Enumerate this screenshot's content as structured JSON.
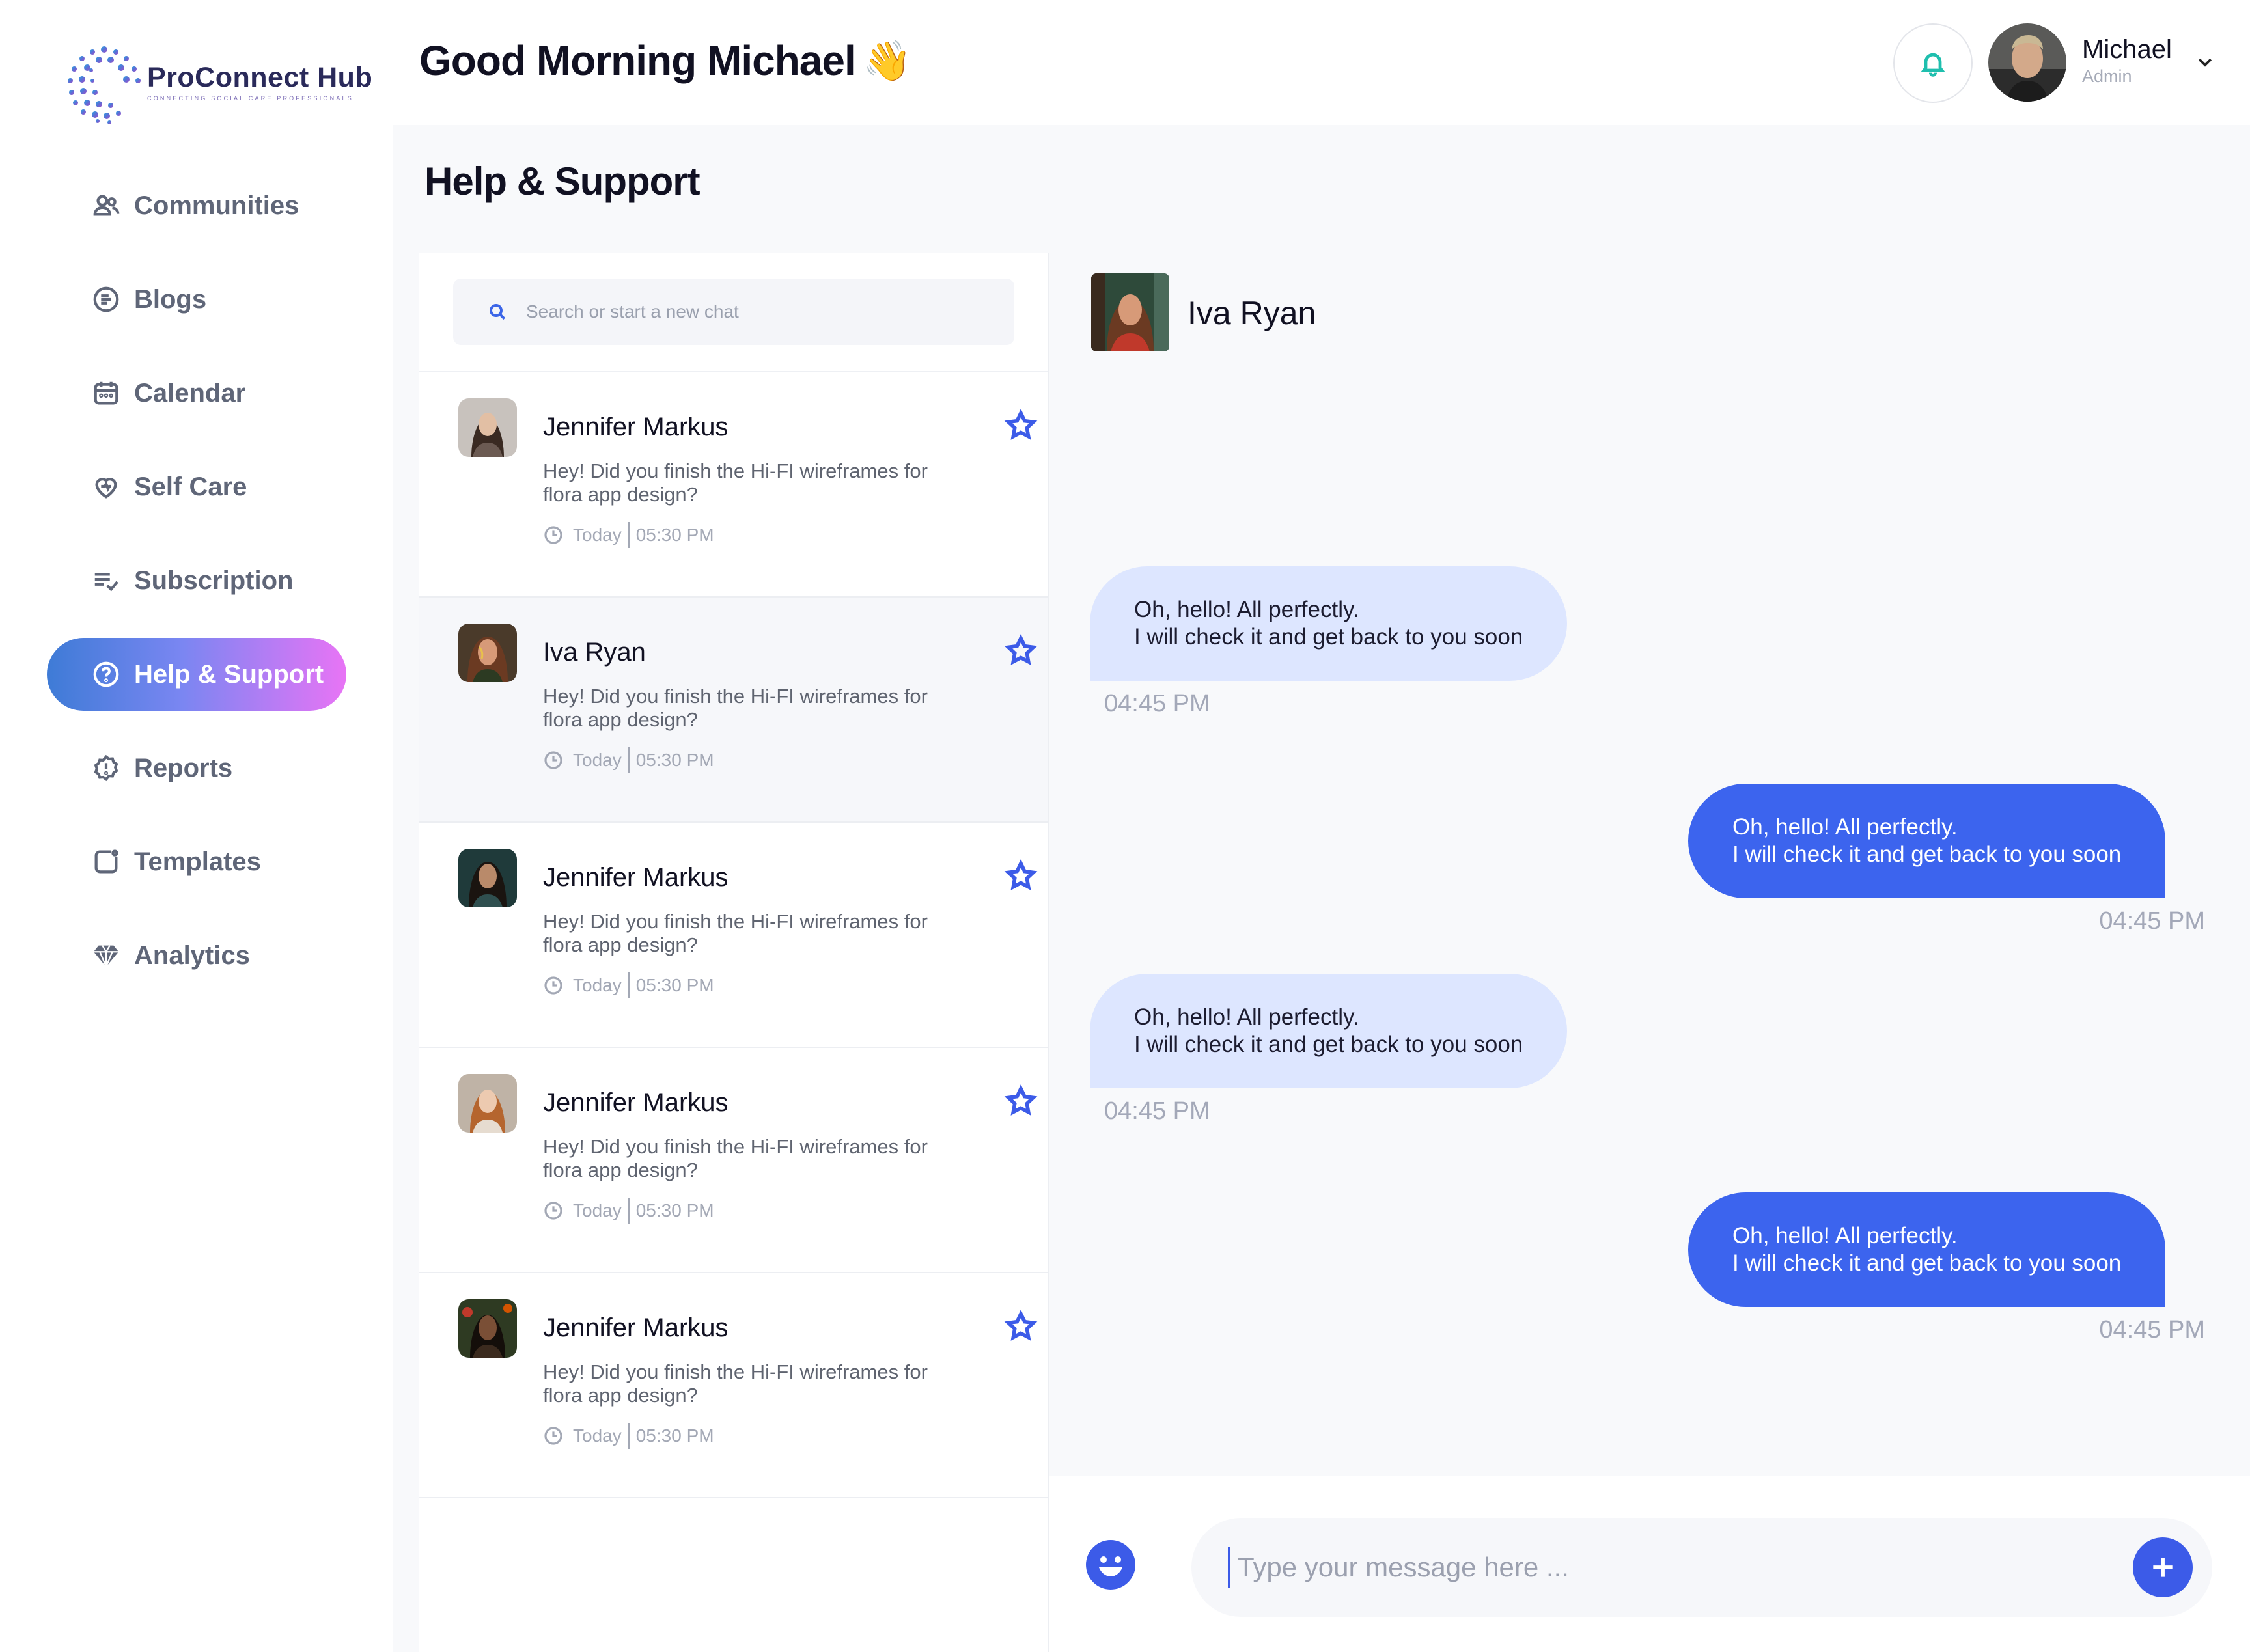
{
  "brand": {
    "name": "ProConnect Hub",
    "tagline": "CONNECTING SOCIAL CARE PROFESSIONALS",
    "accent": "#3c5be8",
    "gradient": [
      "#3e7bd6",
      "#7a86f2",
      "#e874f5"
    ]
  },
  "header": {
    "greeting": "Good Morning Michael",
    "greeting_emoji": "👋",
    "user": {
      "name": "Michael",
      "role": "Admin"
    }
  },
  "sidebar": {
    "items": [
      {
        "label": "Communities",
        "icon": "users-icon",
        "active": false
      },
      {
        "label": "Blogs",
        "icon": "blog-icon",
        "active": false
      },
      {
        "label": "Calendar",
        "icon": "calendar-icon",
        "active": false
      },
      {
        "label": "Self Care",
        "icon": "heart-icon",
        "active": false
      },
      {
        "label": "Subscription",
        "icon": "list-check-icon",
        "active": false
      },
      {
        "label": "Help & Support",
        "icon": "help-circle-icon",
        "active": true
      },
      {
        "label": "Reports",
        "icon": "alert-badge-icon",
        "active": false
      },
      {
        "label": "Templates",
        "icon": "template-icon",
        "active": false
      },
      {
        "label": "Analytics",
        "icon": "gem-icon",
        "active": false
      }
    ]
  },
  "page": {
    "title": "Help & Support"
  },
  "search": {
    "placeholder": "Search or start a new chat"
  },
  "chats": [
    {
      "name": "Jennifer Markus",
      "preview": "Hey! Did you finish the Hi-FI wireframes for flora app design?",
      "day": "Today",
      "time": "05:30 PM",
      "selected": false
    },
    {
      "name": "Iva Ryan",
      "preview": "Hey! Did you finish the Hi-FI wireframes for flora app design?",
      "day": "Today",
      "time": "05:30 PM",
      "selected": true
    },
    {
      "name": "Jennifer Markus",
      "preview": "Hey! Did you finish the Hi-FI wireframes for flora app design?",
      "day": "Today",
      "time": "05:30 PM",
      "selected": false
    },
    {
      "name": "Jennifer Markus",
      "preview": "Hey! Did you finish the Hi-FI wireframes for flora app design?",
      "day": "Today",
      "time": "05:30 PM",
      "selected": false
    },
    {
      "name": "Jennifer Markus",
      "preview": "Hey! Did you finish the Hi-FI wireframes for flora app design?",
      "day": "Today",
      "time": "05:30 PM",
      "selected": false
    }
  ],
  "conversation": {
    "contact": "Iva Ryan",
    "messages": [
      {
        "direction": "in",
        "line1": "Oh, hello! All perfectly.",
        "line2": "I will check it and get back to you soon",
        "time": "04:45 PM"
      },
      {
        "direction": "out",
        "line1": "Oh, hello! All perfectly.",
        "line2": "I will check it and get back to you soon",
        "time": "04:45 PM"
      },
      {
        "direction": "in",
        "line1": "Oh, hello! All perfectly.",
        "line2": "I will check it and get back to you soon",
        "time": "04:45 PM"
      },
      {
        "direction": "out",
        "line1": "Oh, hello! All perfectly.",
        "line2": "I will check it and get back to you soon",
        "time": "04:45 PM"
      }
    ]
  },
  "composer": {
    "placeholder": "Type your message here ..."
  }
}
